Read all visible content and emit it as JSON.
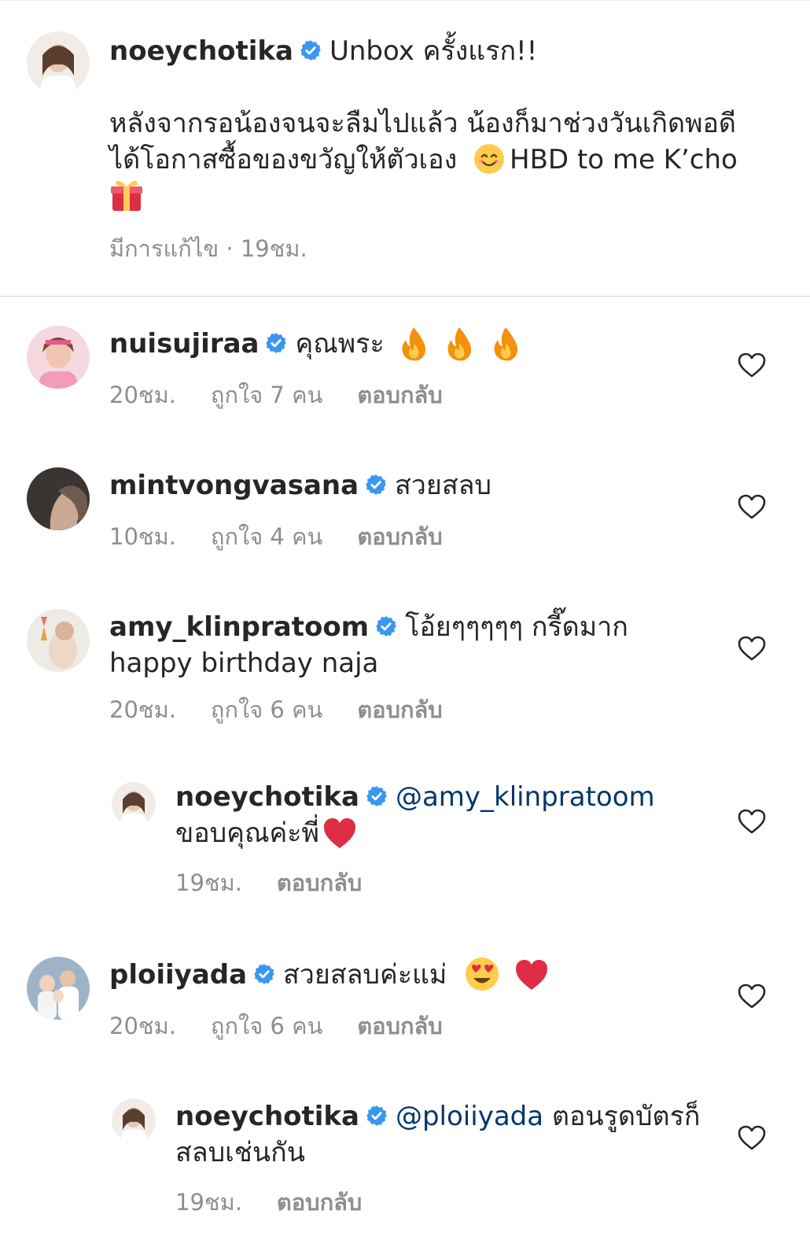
{
  "caption": {
    "username": "noeychotika",
    "title": "Unbox ครั้งแรก!!",
    "line1": "หลังจากรอน้องจนจะลืมไปแล้ว  น้องก็มาช่วงวันเกิดพอดี",
    "line2": "ได้โอกาสซื้อของขวัญให้ตัวเอง",
    "line2_end": "HBD to me K’cho",
    "meta": "มีการแก้ไข · 19ชม."
  },
  "comments": [
    {
      "username": "nuisujiraa",
      "text": "คุณพระ",
      "time": "20ชม.",
      "likes": "ถูกใจ 7 คน",
      "reply": "ตอบกลับ"
    },
    {
      "username": "mintvongvasana",
      "text": "สวยสลบ",
      "time": "10ชม.",
      "likes": "ถูกใจ 4 คน",
      "reply": "ตอบกลับ"
    },
    {
      "username": "amy_klinpratoom",
      "text": "โอ้ยๆๆๆๆๆ กรี๊ดมาก",
      "text2": "happy birthday naja",
      "time": "20ชม.",
      "likes": "ถูกใจ 6 คน",
      "reply": "ตอบกลับ"
    },
    {
      "username": "noeychotika",
      "mention": "@amy_klinpratoom",
      "text2": "ขอบคุณค่ะพี่",
      "time": "19ชม.",
      "reply": "ตอบกลับ"
    },
    {
      "username": "ploiiyada",
      "text": "สวยสลบค่ะแม่",
      "time": "20ชม.",
      "likes": "ถูกใจ 6 คน",
      "reply": "ตอบกลับ"
    },
    {
      "username": "noeychotika",
      "mention": "@ploiiyada",
      "text": "ตอนรูดบัตรก็",
      "text2": "สลบเช่นกัน",
      "time": "19ชม.",
      "reply": "ตอบกลับ"
    }
  ],
  "icons": {
    "verified": "verified-badge-icon",
    "like": "heart-outline-icon",
    "fire": "fire-emoji-icon",
    "gift": "gift-emoji-icon",
    "smile": "smiling-face-emoji-icon",
    "heart": "red-heart-emoji-icon",
    "heart_eyes": "heart-eyes-emoji-icon"
  },
  "colors": {
    "verified_blue": "#3897f0",
    "mention": "#00376b",
    "meta_gray": "#8e8e8e",
    "text": "#262626"
  }
}
